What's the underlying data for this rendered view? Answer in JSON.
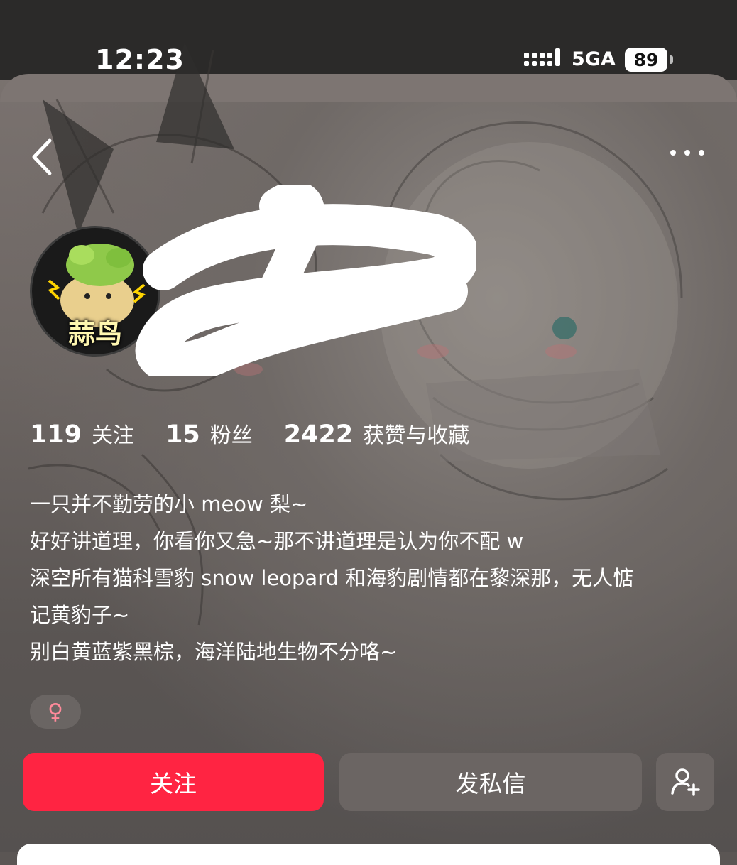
{
  "status_bar": {
    "time": "12:23",
    "network": "5GA",
    "battery": "89"
  },
  "header": {
    "back_icon": "chevron-left-icon",
    "more_icon": "ellipsis-icon"
  },
  "profile": {
    "avatar_text": "蒜鸟",
    "stats": [
      {
        "value": "119",
        "label": "关注"
      },
      {
        "value": "15",
        "label": "粉丝"
      },
      {
        "value": "2422",
        "label": "获赞与收藏"
      }
    ],
    "bio_lines": [
      "一只并不勤劳的小 meow 梨~",
      "好好讲道理，你看你又急~那不讲道理是认为你不配 w",
      "深空所有猫科雪豹 snow leopard 和海豹剧情都在黎深那，无人惦",
      "记黄豹子~",
      "别白黄蓝紫黑棕，海洋陆地生物不分咯~"
    ],
    "gender_symbol": "♀"
  },
  "actions": {
    "follow_label": "关注",
    "message_label": "发私信",
    "add_friend_icon": "add-user-icon"
  },
  "colors": {
    "accent": "#ff2442",
    "button_gray": "#6b6563",
    "gender_pink": "#ff8a9a"
  }
}
